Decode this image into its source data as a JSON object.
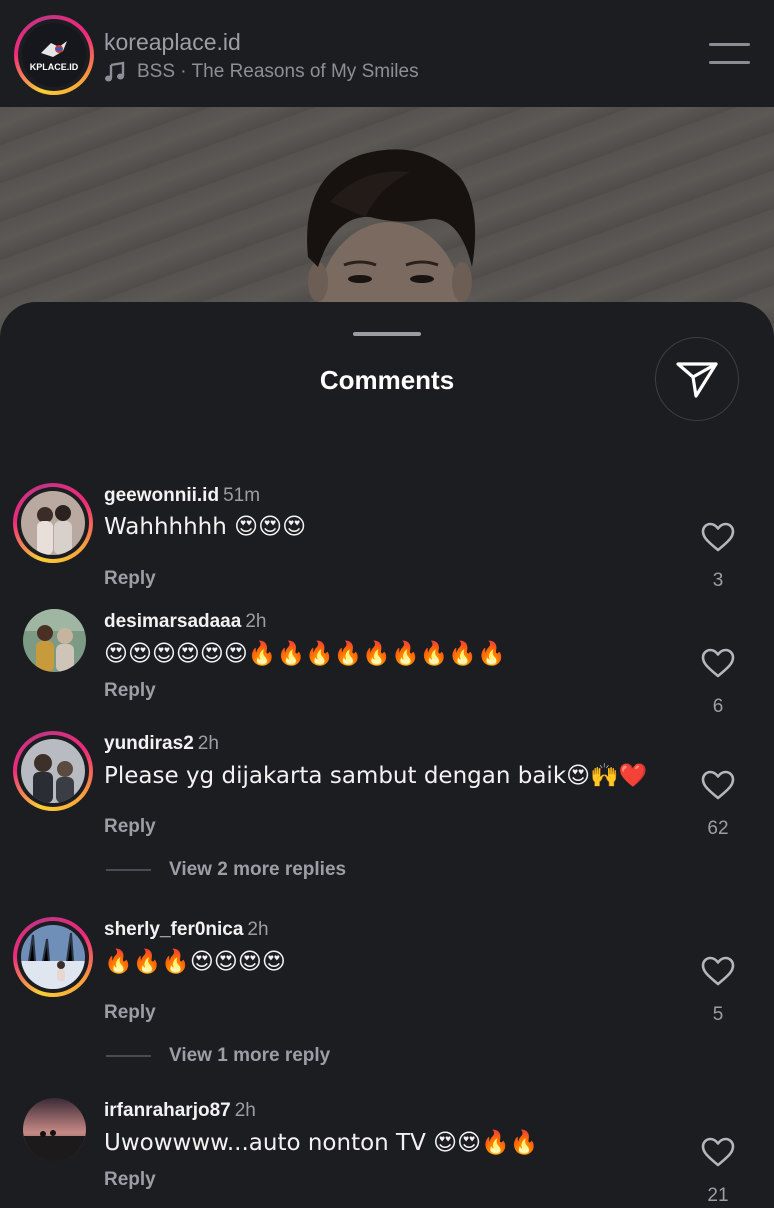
{
  "header": {
    "username": "koreaplace.id",
    "logo_text": "KPLACE.ID",
    "song": "BSS · The Reasons of My Smiles",
    "icons": {
      "music": "music-note-icon",
      "menu": "hamburger-menu-icon"
    }
  },
  "sheet": {
    "title": "Comments",
    "send_icon": "paper-plane-icon"
  },
  "comments": [
    {
      "username": "geewonnii.id",
      "time": "51m",
      "text": "Wahhhhhh 😍😍😍",
      "reply": "Reply",
      "likes": "3",
      "story_ring": true
    },
    {
      "username": "desimarsadaaa",
      "time": "2h",
      "text": "😍😍😍😍😍😍🔥🔥🔥🔥🔥🔥🔥🔥🔥",
      "reply": "Reply",
      "likes": "6",
      "story_ring": false
    },
    {
      "username": "yundiras2",
      "time": "2h",
      "text": "Please yg dijakarta sambut dengan baik😍🙌❤️",
      "reply": "Reply",
      "likes": "62",
      "story_ring": true,
      "more_replies": "View 2 more replies"
    },
    {
      "username": "sherly_fer0nica",
      "time": "2h",
      "text": "🔥🔥🔥😍😍😍😍",
      "reply": "Reply",
      "likes": "5",
      "story_ring": true,
      "more_replies": "View 1 more reply"
    },
    {
      "username": "irfanraharjo87",
      "time": "2h",
      "text": "Uwowwww...auto nonton TV 😍😍🔥🔥",
      "reply": "Reply",
      "likes": "21",
      "story_ring": false
    }
  ],
  "colors": {
    "background": "#1c1d20",
    "primary_text": "#f2f2f2",
    "secondary_text": "#9b9ea6",
    "story_ring": [
      "#f9ce34",
      "#ee2a7b",
      "#c13584"
    ]
  }
}
